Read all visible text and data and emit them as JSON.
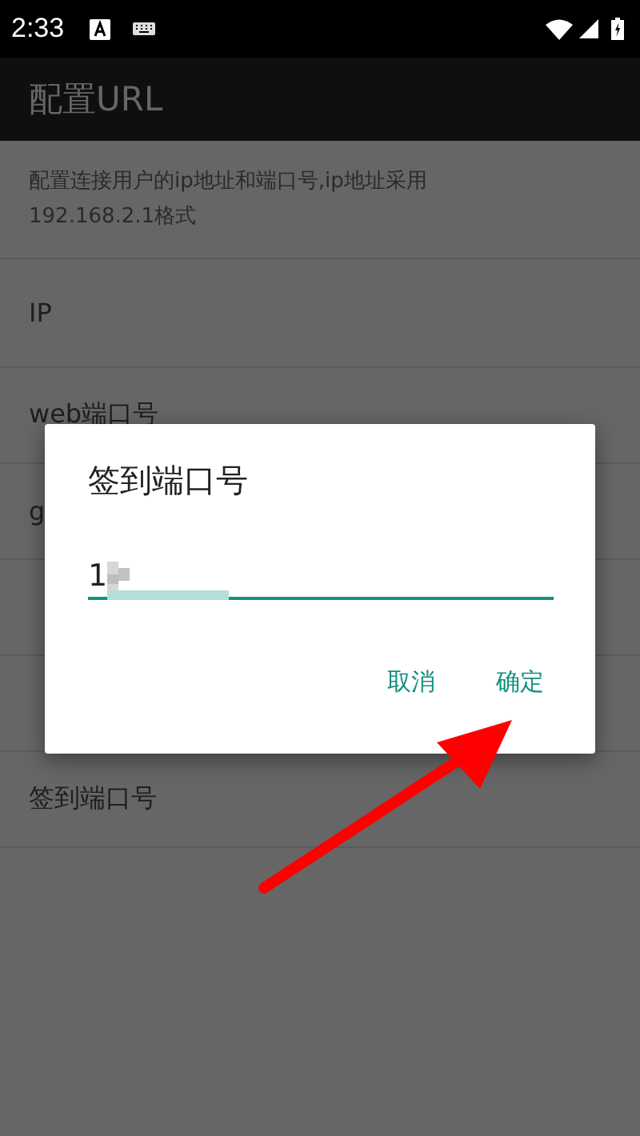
{
  "status_bar": {
    "time": "2:33"
  },
  "app_bar": {
    "title": "配置URL"
  },
  "preferences": [
    {
      "kind": "note",
      "text": "配置连接用户的ip地址和端口号,ip地址采用192.168.2.1格式"
    },
    {
      "kind": "item",
      "text": "IP"
    },
    {
      "kind": "item",
      "text": "web端口号"
    },
    {
      "kind": "item",
      "text": "g"
    },
    {
      "kind": "blank"
    },
    {
      "kind": "blank"
    },
    {
      "kind": "item",
      "text": "签到端口号"
    }
  ],
  "dialog": {
    "title": "签到端口号",
    "value": "1",
    "value_masked": true,
    "buttons": [
      "取消",
      "确定"
    ]
  },
  "pointer_arrow": true
}
